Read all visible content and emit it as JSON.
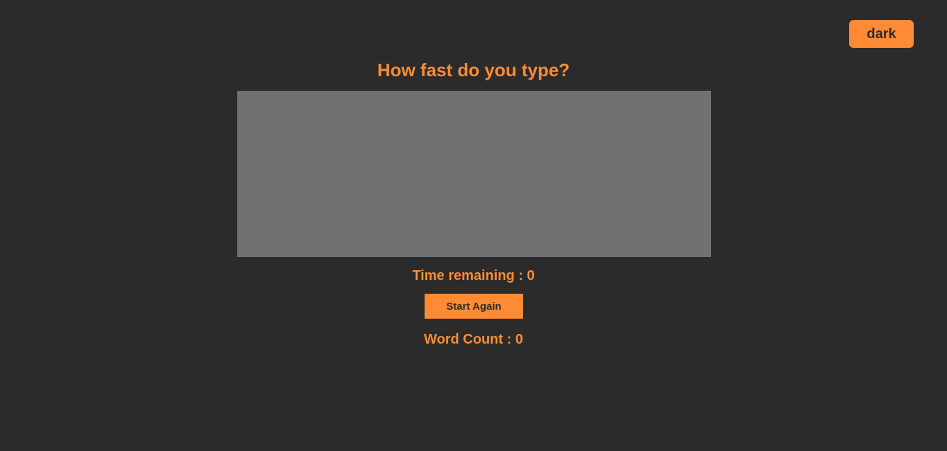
{
  "theme": {
    "toggle_label": "dark",
    "accent_color": "#ff8c35",
    "background_color": "#2b2b2b",
    "input_background_color": "#717171"
  },
  "main": {
    "title": "How fast do you type?",
    "typing_area_value": "",
    "time_remaining_label": "Time remaining : ",
    "time_remaining_value": "0",
    "start_button_label": "Start Again",
    "word_count_label": "Word Count : ",
    "word_count_value": "0"
  }
}
